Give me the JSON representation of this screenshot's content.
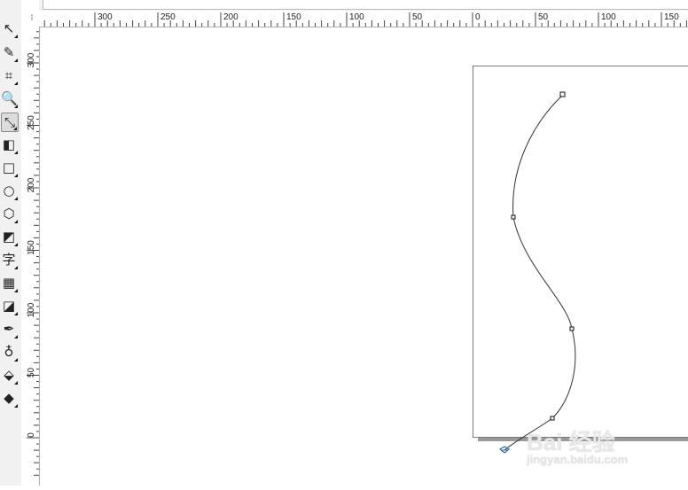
{
  "toolbox": {
    "tools": [
      {
        "name": "pick-tool",
        "icon": "pointer-arrow-icon",
        "glyph": "↖"
      },
      {
        "name": "shape-tool",
        "icon": "shape-edit-icon",
        "glyph": "✎"
      },
      {
        "name": "crop-tool",
        "icon": "crop-icon",
        "glyph": "⌗"
      },
      {
        "name": "zoom-tool",
        "icon": "magnifier-icon",
        "glyph": "🔍"
      },
      {
        "name": "freehand-tool",
        "icon": "curve-pen-icon",
        "glyph": "⤡"
      },
      {
        "name": "smart-fill-tool",
        "icon": "smart-fill-icon",
        "glyph": "◧"
      },
      {
        "name": "rectangle-tool",
        "icon": "rectangle-icon",
        "glyph": "□"
      },
      {
        "name": "ellipse-tool",
        "icon": "ellipse-icon",
        "glyph": "○"
      },
      {
        "name": "polygon-tool",
        "icon": "hexagon-icon",
        "glyph": "⬡"
      },
      {
        "name": "basic-shapes-tool",
        "icon": "basic-shapes-icon",
        "glyph": "◩"
      },
      {
        "name": "text-tool",
        "icon": "text-icon",
        "glyph": "字"
      },
      {
        "name": "table-tool",
        "icon": "table-grid-icon",
        "glyph": "▦"
      },
      {
        "name": "interactive-tool",
        "icon": "blend-icon",
        "glyph": "◪"
      },
      {
        "name": "eyedropper-tool",
        "icon": "eyedropper-icon",
        "glyph": "✒"
      },
      {
        "name": "outline-tool",
        "icon": "pen-nib-icon",
        "glyph": "♁"
      },
      {
        "name": "fill-tool",
        "icon": "fill-bucket-icon",
        "glyph": "⬙"
      },
      {
        "name": "interactive-fill-tool",
        "icon": "interactive-fill-icon",
        "glyph": "◆"
      }
    ],
    "active_tool": "freehand-tool"
  },
  "rulers": {
    "corner_glyph": "⁝",
    "x_ticks": [
      "300",
      "250",
      "200",
      "150",
      "100",
      "50",
      "0",
      "50",
      "100",
      "150"
    ],
    "y_ticks": [
      "300",
      "250",
      "200",
      "150",
      "100",
      "50",
      "0"
    ]
  },
  "colors": {
    "curve": "#333333",
    "node_stroke": "#111111",
    "cursor": "#2a6fb0",
    "page_border": "#7a7a7a",
    "page_shadow": "#9a9a9a"
  },
  "watermark": {
    "main": "Bai 经验",
    "sub": "jingyan.baidu.com"
  }
}
